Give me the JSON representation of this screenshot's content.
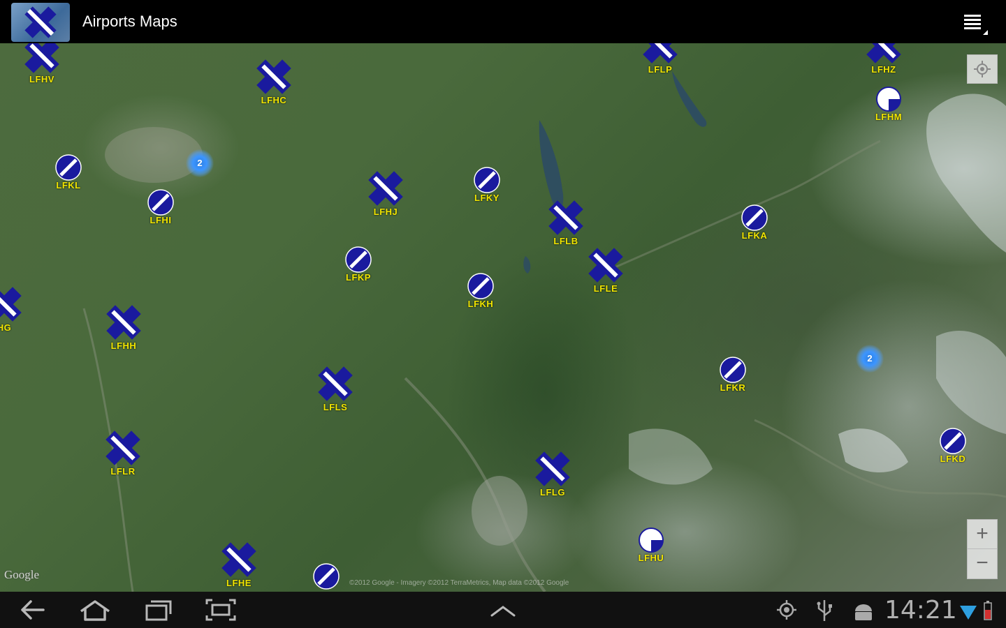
{
  "app": {
    "title": "Airports Maps"
  },
  "map": {
    "attribution": "Google",
    "copyright": "©2012 Google - Imagery ©2012 TerraMetrics, Map data ©2012 Google",
    "airports": [
      {
        "code": "LFHV",
        "type": "cross"
      },
      {
        "code": "LFHC",
        "type": "cross"
      },
      {
        "code": "LFLP",
        "type": "cross"
      },
      {
        "code": "LFHZ",
        "type": "cross"
      },
      {
        "code": "LFHM",
        "type": "half"
      },
      {
        "code": "LFKL",
        "type": "disc"
      },
      {
        "code": "LFHI",
        "type": "disc"
      },
      {
        "code": "LFHJ",
        "type": "cross"
      },
      {
        "code": "LFKY",
        "type": "disc"
      },
      {
        "code": "LFLB",
        "type": "cross"
      },
      {
        "code": "LFLE",
        "type": "cross"
      },
      {
        "code": "LFKA",
        "type": "disc"
      },
      {
        "code": "LFKP",
        "type": "disc"
      },
      {
        "code": "LFKH",
        "type": "disc"
      },
      {
        "code": "HG",
        "type": "cross"
      },
      {
        "code": "LFHH",
        "type": "cross"
      },
      {
        "code": "LFLS",
        "type": "cross"
      },
      {
        "code": "LFKR",
        "type": "disc"
      },
      {
        "code": "LFKD",
        "type": "disc"
      },
      {
        "code": "LFLR",
        "type": "cross"
      },
      {
        "code": "LFLG",
        "type": "cross"
      },
      {
        "code": "LFHU",
        "type": "half"
      },
      {
        "code": "LFHE",
        "type": "cross"
      },
      {
        "code": "",
        "type": "disc"
      }
    ],
    "clusters": [
      {
        "count": "2"
      },
      {
        "count": "2"
      }
    ],
    "zoom_in": "+",
    "zoom_out": "−"
  },
  "status": {
    "time": "14:21"
  },
  "colors": {
    "pin_blue": "#1a1a9e",
    "label_yellow": "#f2e600",
    "cluster_blue": "#3c95ff"
  },
  "icons": [
    "back-icon",
    "home-icon",
    "recent-apps-icon",
    "screenshot-icon",
    "up-chevron-icon",
    "gps-icon",
    "usb-icon",
    "android-icon",
    "wifi-icon",
    "battery-icon"
  ]
}
